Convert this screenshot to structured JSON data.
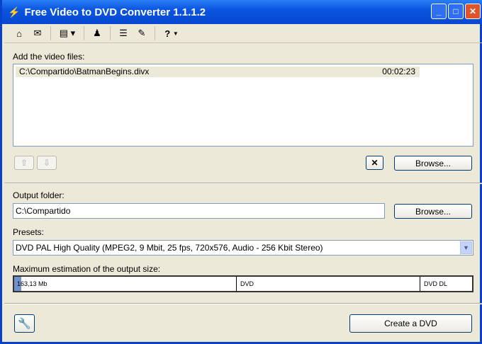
{
  "window": {
    "title": "Free Video to DVD Converter 1.1.1.2"
  },
  "toolbar": {
    "help": "?"
  },
  "files": {
    "label": "Add the video files:",
    "items": [
      {
        "path": "C:\\Compartido\\BatmanBegins.divx",
        "duration": "00:02:23"
      }
    ],
    "browse": "Browse..."
  },
  "output": {
    "label": "Output folder:",
    "value": "C:\\Compartido",
    "browse": "Browse..."
  },
  "presets": {
    "label": "Presets:",
    "value": "DVD PAL High Quality (MPEG2, 9 Mbit, 25 fps, 720x576, Audio - 256 Kbit Stereo)"
  },
  "estimate": {
    "label": "Maximum estimation of the output size:",
    "size": "163,13 Mb",
    "fill_fraction": 0.016,
    "dvd": "DVD",
    "dvd_dl": "DVD DL"
  },
  "create": "Create a DVD"
}
